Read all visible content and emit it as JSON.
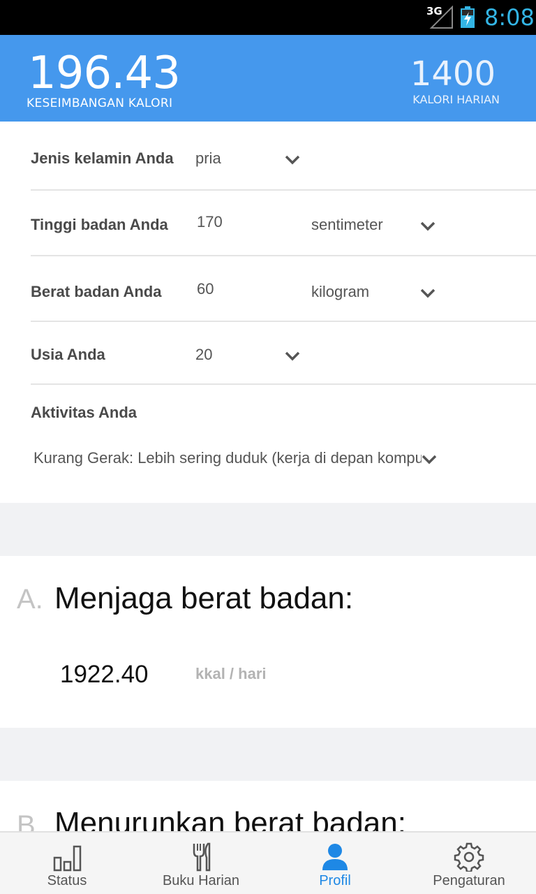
{
  "status_bar": {
    "network": "3G",
    "time": "8:08"
  },
  "header": {
    "balance_value": "196.43",
    "balance_label": "KESEIMBANGAN KALORI",
    "daily_value": "1400",
    "daily_label": "KALORI HARIAN"
  },
  "profile": {
    "gender": {
      "label": "Jenis kelamin Anda",
      "value": "pria"
    },
    "height": {
      "label": "Tinggi badan Anda",
      "value": "170",
      "unit": "sentimeter"
    },
    "weight": {
      "label": "Berat badan Anda",
      "value": "60",
      "unit": "kilogram"
    },
    "age": {
      "label": "Usia Anda",
      "value": "20"
    },
    "activity": {
      "label": "Aktivitas Anda",
      "value": "Kurang Gerak: Lebih sering duduk (kerja di depan komputer)"
    }
  },
  "cards": [
    {
      "letter": "A.",
      "title": "Menjaga berat badan:",
      "value": "1922.40",
      "unit": "kkal / hari"
    },
    {
      "letter": "B.",
      "title": "Menurunkan berat badan:"
    }
  ],
  "bottom_nav": [
    {
      "label": "Status",
      "icon": "bar-chart-icon",
      "active": false
    },
    {
      "label": "Buku Harian",
      "icon": "fork-knife-icon",
      "active": false
    },
    {
      "label": "Profil",
      "icon": "person-icon",
      "active": true
    },
    {
      "label": "Pengaturan",
      "icon": "gear-icon",
      "active": false
    }
  ],
  "colors": {
    "header": "#4598ed",
    "active_tab": "#1e88e5",
    "status_time": "#33b5e5"
  }
}
